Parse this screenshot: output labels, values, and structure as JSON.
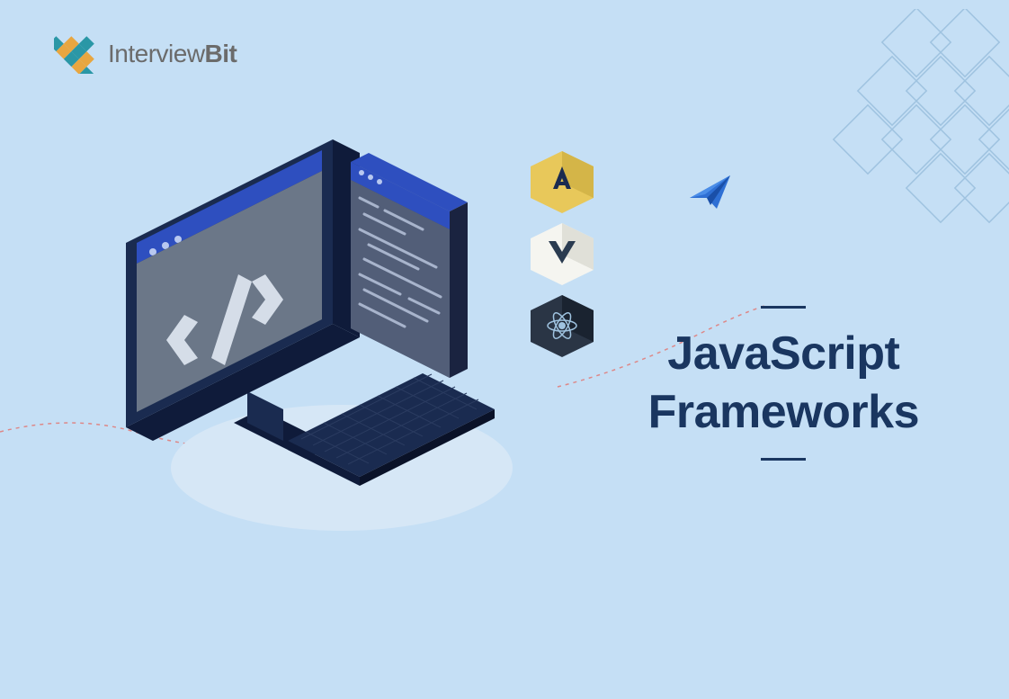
{
  "logo": {
    "brand_prefix": "Interview",
    "brand_suffix": "Bit"
  },
  "title": {
    "line1": "JavaScript",
    "line2": "Frameworks"
  },
  "icons": {
    "angular": "A",
    "vue": "V",
    "react": "react"
  }
}
